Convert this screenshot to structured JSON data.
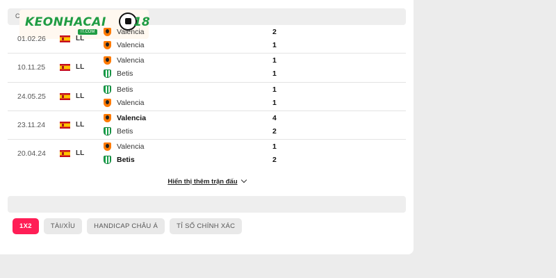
{
  "section": {
    "title": "C"
  },
  "logo": {
    "text": "KEONHACAI",
    "num": "18",
    "sub": "IT.COM"
  },
  "matches": [
    {
      "date": "01.02.26",
      "league": "LL",
      "home": {
        "name": "Valencia",
        "crest": "valencia-crest-icon",
        "winner": false
      },
      "away": {
        "name": "Valencia",
        "crest": "valencia-crest-icon",
        "winner": false
      },
      "score_home": "2",
      "score_away": "1"
    },
    {
      "date": "10.11.25",
      "league": "LL",
      "home": {
        "name": "Valencia",
        "crest": "valencia-crest-icon",
        "winner": false
      },
      "away": {
        "name": "Betis",
        "crest": "betis-crest-icon",
        "winner": false
      },
      "score_home": "1",
      "score_away": "1"
    },
    {
      "date": "24.05.25",
      "league": "LL",
      "home": {
        "name": "Betis",
        "crest": "betis-crest-icon",
        "winner": false
      },
      "away": {
        "name": "Valencia",
        "crest": "valencia-crest-icon",
        "winner": false
      },
      "score_home": "1",
      "score_away": "1"
    },
    {
      "date": "23.11.24",
      "league": "LL",
      "home": {
        "name": "Valencia",
        "crest": "valencia-crest-icon",
        "winner": true
      },
      "away": {
        "name": "Betis",
        "crest": "betis-crest-icon",
        "winner": false
      },
      "score_home": "4",
      "score_away": "2"
    },
    {
      "date": "20.04.24",
      "league": "LL",
      "home": {
        "name": "Valencia",
        "crest": "valencia-crest-icon",
        "winner": false
      },
      "away": {
        "name": "Betis",
        "crest": "betis-crest-icon",
        "winner": true
      },
      "score_home": "1",
      "score_away": "2"
    }
  ],
  "show_more": {
    "label": "Hiển thị thêm trận đấu",
    "icon": "chevron-down-icon"
  },
  "tabs": [
    {
      "label": "1X2",
      "active": true
    },
    {
      "label": "TÀI/XỈU",
      "active": false
    },
    {
      "label": "HANDICAP CHÂU Á",
      "active": false
    },
    {
      "label": "TỈ SỐ CHÍNH XÁC",
      "active": false
    }
  ],
  "colors": {
    "accent": "#ff1e56",
    "brand_green": "#1f9c43",
    "valencia_orange": "#ff7a00",
    "betis_green": "#16a34a"
  }
}
